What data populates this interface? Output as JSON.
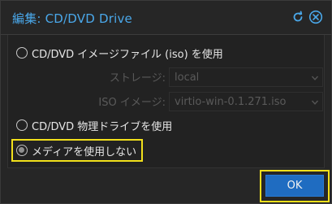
{
  "dialog": {
    "title": "編集: CD/DVD Drive",
    "reset_icon": "reset-icon",
    "close_icon": "close-circle-icon"
  },
  "options": {
    "iso": {
      "label": "CD/DVD イメージファイル (iso) を使用",
      "checked": false,
      "storage": {
        "label": "ストレージ:",
        "value": "local"
      },
      "iso_image": {
        "label": "ISO イメージ:",
        "value": "virtio-win-0.1.271.iso"
      }
    },
    "physical": {
      "label": "CD/DVD 物理ドライブを使用",
      "checked": false
    },
    "none": {
      "label": "メディアを使用しない",
      "checked": true
    }
  },
  "footer": {
    "ok_label": "OK"
  },
  "colors": {
    "accent": "#4aa8ea",
    "button": "#1f6cc1",
    "highlight": "#f2e01b"
  }
}
